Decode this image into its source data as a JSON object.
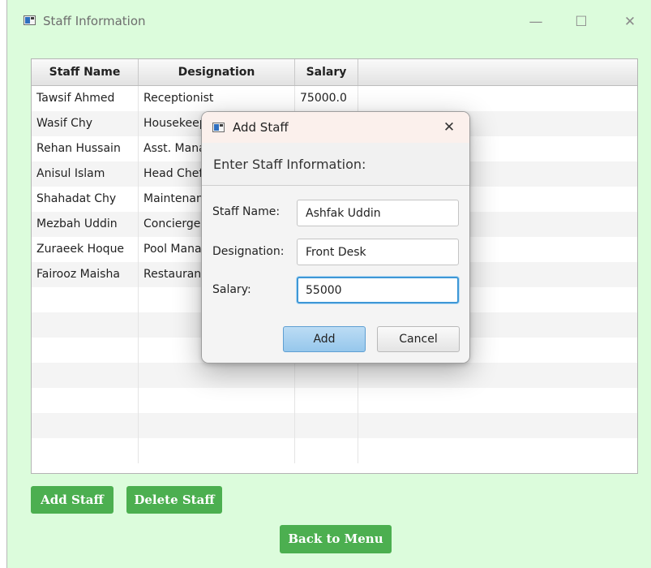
{
  "window": {
    "title": "Staff Information"
  },
  "table": {
    "columns": [
      "Staff Name",
      "Designation",
      "Salary"
    ],
    "rows": [
      [
        "Tawsif Ahmed",
        "Receptionist",
        "75000.0"
      ],
      [
        "Wasif Chy",
        "Housekeeping",
        ""
      ],
      [
        "Rehan Hussain",
        "Asst. Manager",
        ""
      ],
      [
        "Anisul Islam",
        "Head Chef",
        ""
      ],
      [
        "Shahadat Chy",
        "Maintenance",
        ""
      ],
      [
        "Mezbah Uddin",
        "Concierge",
        ""
      ],
      [
        "Zuraeek Hoque",
        "Pool Manager",
        ""
      ],
      [
        "Fairooz Maisha",
        "Restaurant",
        ""
      ]
    ]
  },
  "buttons": {
    "add_staff": "Add Staff",
    "delete_staff": "Delete Staff",
    "back_to_menu": "Back to Menu"
  },
  "dialog": {
    "title": "Add Staff",
    "header": "Enter Staff Information:",
    "fields": [
      {
        "label": "Staff Name:",
        "value": "Ashfak Uddin"
      },
      {
        "label": "Designation:",
        "value": "Front Desk"
      },
      {
        "label": "Salary:",
        "value": "55000"
      }
    ],
    "add_label": "Add",
    "cancel_label": "Cancel"
  },
  "colors": {
    "window_bg": "#dcfcdc",
    "button_green": "#4caf50",
    "dialog_add": "#a6d0f0",
    "focus_blue": "#3e97d6"
  },
  "icons": {
    "app": "app-window-icon",
    "minimize": "minimize-icon",
    "maximize": "maximize-icon",
    "close": "close-icon"
  }
}
